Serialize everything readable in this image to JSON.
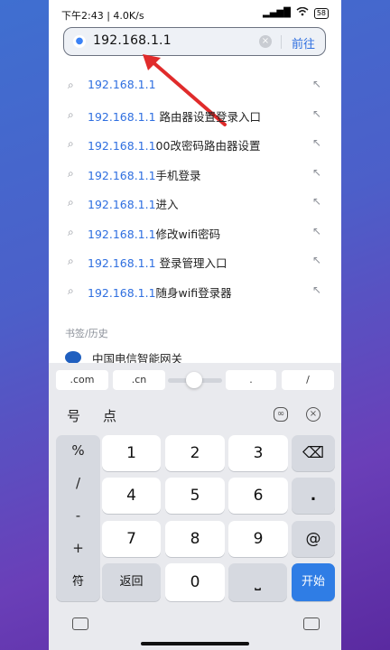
{
  "status": {
    "time": "下午2:43 | 4.0K/s",
    "battery": "58",
    "signal": "▂▄▆█",
    "wifi": "wifi"
  },
  "search": {
    "value": "192.168.1.1",
    "go_label": "前往"
  },
  "suggestions": [
    {
      "hl": "192.168.1.1",
      "rest": ""
    },
    {
      "hl": "192.168.1.1",
      "rest": " 路由器设置登录入口"
    },
    {
      "hl": "192.168.1.1",
      "rest": "00改密码路由器设置"
    },
    {
      "hl": "192.168.1.1",
      "rest": "手机登录"
    },
    {
      "hl": "192.168.1.1",
      "rest": "进入"
    },
    {
      "hl": "192.168.1.1",
      "rest": "修改wifi密码"
    },
    {
      "hl": "192.168.1.1",
      "rest": " 登录管理入口"
    },
    {
      "hl": "192.168.1.1",
      "rest": "随身wifi登录器"
    }
  ],
  "bookmarks": {
    "title": "书签/历史",
    "items": [
      {
        "name": "中国电信智能网关"
      }
    ]
  },
  "keyboard": {
    "quick": [
      ".com",
      ".cn",
      ".",
      "/"
    ],
    "pinyin": [
      "号",
      "点"
    ],
    "symbols": [
      "%",
      "/",
      "-",
      "+"
    ],
    "digits": [
      "1",
      "2",
      "3",
      "4",
      "5",
      "6",
      "7",
      "8",
      "9"
    ],
    "dot": ".",
    "at": "@",
    "sym_label": "符",
    "back_label": "返回",
    "zero": "0",
    "space": "⎵",
    "enter_label": "开始",
    "backspace": "⌫"
  },
  "colors": {
    "accent": "#2f6fe0",
    "enter": "#2f7de5",
    "arrow": "#e02b2b"
  }
}
